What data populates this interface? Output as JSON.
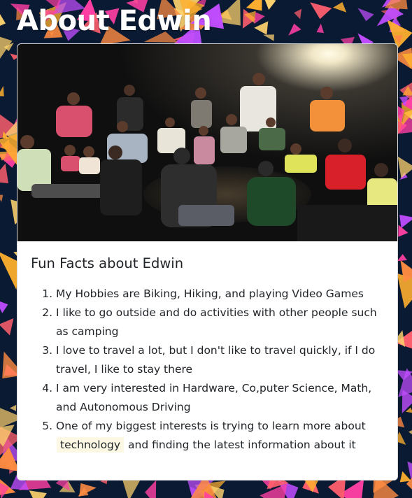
{
  "page": {
    "title": "About Edwin",
    "background_color": "#0b1a33",
    "triangle_colors": [
      "#ff3fa4",
      "#ff8c42",
      "#ffb02e",
      "#c04dff",
      "#ff5f6d",
      "#ffd36e"
    ]
  },
  "card": {
    "photo_alt": "photo",
    "title": "Fun Facts about Edwin",
    "facts": [
      {
        "text": "My Hobbies are Biking, Hiking, and playing Video Games"
      },
      {
        "text": "I like to go outside and do activities with other people such as camping"
      },
      {
        "text": "I love to travel a lot, but I don't like to travel quickly, if I do travel, I like to stay there"
      },
      {
        "text": "I am very interested in Hardware, Co,puter Science, Math, and Autonomous Driving"
      },
      {
        "before": "One of my biggest interests is trying to learn more about",
        "highlight": "technology",
        "after": "and finding the latest information about it"
      }
    ]
  }
}
